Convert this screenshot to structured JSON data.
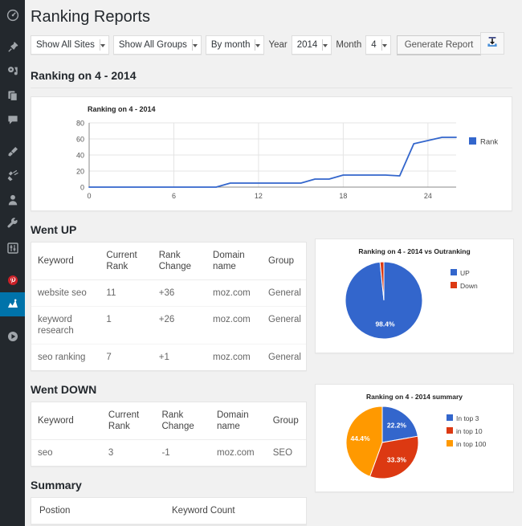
{
  "sidebar": {
    "items": [
      {
        "name": "dashboard",
        "icon": "dashboard-icon",
        "active": false
      },
      {
        "name": "posts",
        "icon": "pin-icon",
        "active": false
      },
      {
        "name": "media",
        "icon": "media-icon",
        "active": false
      },
      {
        "name": "pages",
        "icon": "pages-icon",
        "active": false
      },
      {
        "name": "comments",
        "icon": "comment-icon",
        "active": false
      },
      {
        "name": "appearance",
        "icon": "brush-icon",
        "active": false
      },
      {
        "name": "plugins",
        "icon": "plug-icon",
        "active": false
      },
      {
        "name": "users",
        "icon": "user-icon",
        "active": false
      },
      {
        "name": "tools",
        "icon": "wrench-icon",
        "active": false
      },
      {
        "name": "settings",
        "icon": "sliders-icon",
        "active": false
      },
      {
        "name": "pinterest",
        "icon": "pinterest-icon",
        "active": false
      },
      {
        "name": "rankings",
        "icon": "chart-icon",
        "active": true
      },
      {
        "name": "media-player",
        "icon": "play-circle-icon",
        "active": false
      }
    ]
  },
  "header": {
    "title": "Ranking Reports"
  },
  "toolbar": {
    "site_select": "Show All Sites",
    "group_select": "Show All Groups",
    "period_select": "By month",
    "year_label": "Year",
    "year_select": "2014",
    "month_label": "Month",
    "month_select": "4",
    "generate_button": "Generate Report",
    "export_icon": "download-icon"
  },
  "sections": {
    "ranking": "Ranking on 4 - 2014",
    "went_up": "Went UP",
    "went_down": "Went DOWN",
    "summary": "Summary"
  },
  "tables": {
    "headers": [
      "Keyword",
      "Current Rank",
      "Rank Change",
      "Domain name",
      "Group"
    ],
    "went_up_rows": [
      [
        "website seo",
        "11",
        "+36",
        "moz.com",
        "General"
      ],
      [
        "keyword research",
        "1",
        "+26",
        "moz.com",
        "General"
      ],
      [
        "seo ranking",
        "7",
        "+1",
        "moz.com",
        "General"
      ]
    ],
    "went_down_rows": [
      [
        "seo",
        "3",
        "-1",
        "moz.com",
        "SEO"
      ]
    ],
    "summary_headers": [
      "Postion",
      "Keyword Count"
    ]
  },
  "colors": {
    "line": "#3366cc",
    "blue": "#3366cc",
    "red": "#dc3912",
    "orange": "#ff9900",
    "accent": "#0073aa",
    "sidebar_bg": "#23282d",
    "page_bg": "#f1f1f1"
  },
  "chart_data": [
    {
      "type": "line",
      "title": "Ranking on 4 - 2014",
      "xlabel": "",
      "ylabel": "",
      "xlim": [
        0,
        26
      ],
      "ylim": [
        0,
        80
      ],
      "xticks": [
        0,
        6,
        12,
        18,
        24
      ],
      "yticks": [
        0,
        20,
        40,
        60,
        80
      ],
      "grid": true,
      "legend": [
        "Rank"
      ],
      "legend_position": "right",
      "series": [
        {
          "name": "Rank",
          "color": "#3366cc",
          "x": [
            0,
            1,
            2,
            3,
            4,
            5,
            6,
            7,
            8,
            9,
            10,
            11,
            12,
            13,
            14,
            15,
            16,
            17,
            18,
            19,
            20,
            21,
            22,
            23,
            24,
            25,
            26
          ],
          "values": [
            0,
            0,
            0,
            0,
            0,
            0,
            0,
            0,
            0,
            0,
            5,
            5,
            5,
            5,
            5,
            5,
            10,
            10,
            15,
            15,
            15,
            15,
            14,
            54,
            58,
            62,
            62
          ]
        }
      ]
    },
    {
      "type": "pie",
      "title": "Ranking on 4 - 2014 vs Outranking",
      "labels": [
        "UP",
        "Down"
      ],
      "values": [
        98.4,
        1.6
      ],
      "value_labels": [
        "98.4%",
        ""
      ],
      "colors": [
        "#3366cc",
        "#dc3912"
      ],
      "legend_position": "right"
    },
    {
      "type": "pie",
      "title": "Ranking on 4 - 2014 summary",
      "labels": [
        "In top 3",
        "in top 10",
        "in top 100"
      ],
      "values": [
        22.2,
        33.3,
        44.4
      ],
      "value_labels": [
        "22.2%",
        "33.3%",
        "44.4%"
      ],
      "colors": [
        "#3366cc",
        "#dc3912",
        "#ff9900"
      ],
      "legend_position": "right"
    }
  ]
}
